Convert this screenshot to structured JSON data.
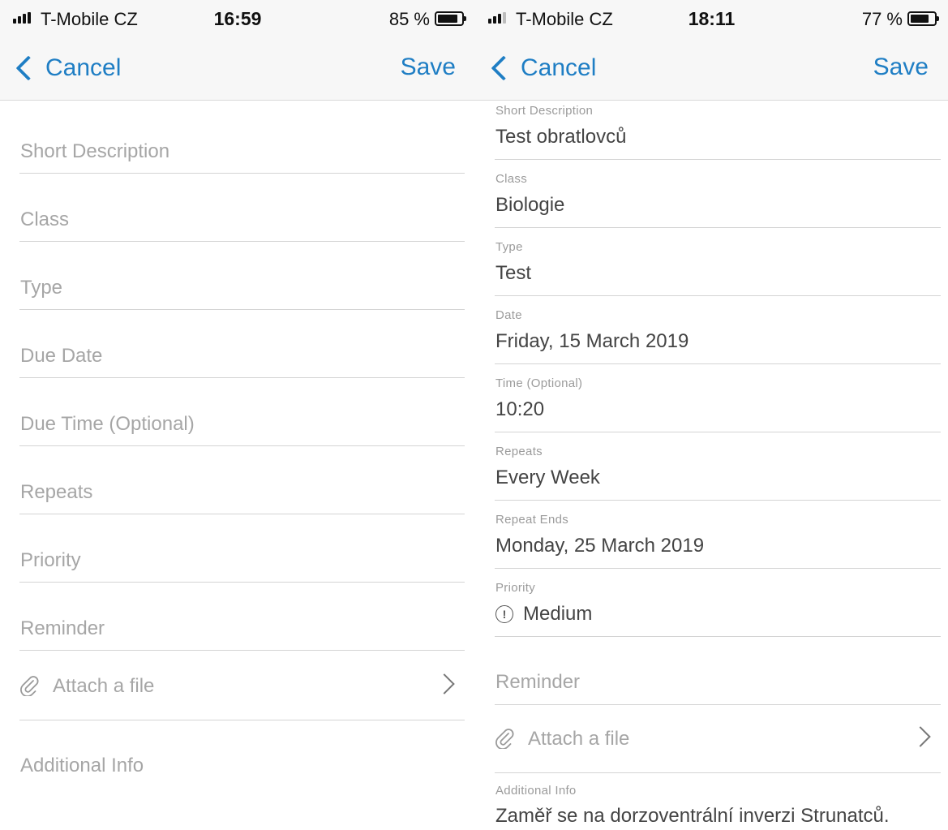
{
  "screens": {
    "left": {
      "status": {
        "carrier": "T-Mobile CZ",
        "time": "16:59",
        "battery_pct": "85 %",
        "battery_level": 0.85,
        "signal_bars": 4
      },
      "nav": {
        "cancel_label": "Cancel",
        "save_label": "Save"
      },
      "placeholders": [
        "Short Description",
        "Class",
        "Type",
        "Due Date",
        "Due Time (Optional)",
        "Repeats",
        "Priority",
        "Reminder"
      ],
      "attach_label": "Attach a file",
      "additional_info_placeholder": "Additional Info"
    },
    "right": {
      "status": {
        "carrier": "T-Mobile CZ",
        "time": "18:11",
        "battery_pct": "77 %",
        "battery_level": 0.77,
        "signal_bars": 3
      },
      "nav": {
        "cancel_label": "Cancel",
        "save_label": "Save"
      },
      "fields": [
        {
          "label": "Short Description",
          "value": "Test obratlovců"
        },
        {
          "label": "Class",
          "value": "Biologie"
        },
        {
          "label": "Type",
          "value": "Test"
        },
        {
          "label": "Date",
          "value": "Friday, 15 March 2019"
        },
        {
          "label": "Time (Optional)",
          "value": "10:20"
        },
        {
          "label": "Repeats",
          "value": "Every Week"
        },
        {
          "label": "Repeat Ends",
          "value": "Monday, 25 March 2019"
        },
        {
          "label": "Priority",
          "value": "Medium",
          "icon": "alert-circle-icon",
          "icon_glyph": "!"
        }
      ],
      "reminder_placeholder": "Reminder",
      "attach_label": "Attach a file",
      "additional_info": {
        "label": "Additional Info",
        "value": "Zaměř se na dorzoventrální inverzi Strunatců."
      }
    }
  },
  "colors": {
    "accent": "#1f7ec4",
    "placeholder": "#a6a6a6",
    "label": "#9b9b9b",
    "value": "#444444",
    "divider": "#d4d4d4",
    "bar": "#f7f7f7"
  }
}
